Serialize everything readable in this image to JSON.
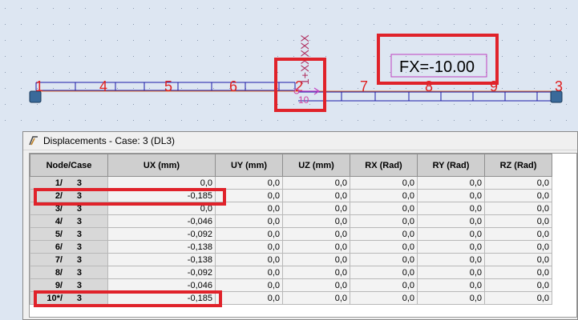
{
  "model": {
    "node_labels": [
      "1",
      "4",
      "5",
      "6",
      "2",
      "7",
      "8",
      "9",
      "3"
    ],
    "inner_node_label": "10",
    "member_label": "1+XXXXX",
    "load_label": "FX=-10.00"
  },
  "window": {
    "title": "Displacements - Case: 3 (DL3)",
    "icon": "table-window-icon"
  },
  "table": {
    "headers": [
      "Node/Case",
      "UX (mm)",
      "UY (mm)",
      "UZ (mm)",
      "RX (Rad)",
      "RY (Rad)",
      "RZ (Rad)"
    ],
    "rows": [
      {
        "node": "1/",
        "case": "3",
        "ux": "0,0",
        "uy": "0,0",
        "uz": "0,0",
        "rx": "0,0",
        "ry": "0,0",
        "rz": "0,0"
      },
      {
        "node": "2/",
        "case": "3",
        "ux": "-0,185",
        "uy": "0,0",
        "uz": "0,0",
        "rx": "0,0",
        "ry": "0,0",
        "rz": "0,0"
      },
      {
        "node": "3/",
        "case": "3",
        "ux": "0,0",
        "uy": "0,0",
        "uz": "0,0",
        "rx": "0,0",
        "ry": "0,0",
        "rz": "0,0"
      },
      {
        "node": "4/",
        "case": "3",
        "ux": "-0,046",
        "uy": "0,0",
        "uz": "0,0",
        "rx": "0,0",
        "ry": "0,0",
        "rz": "0,0"
      },
      {
        "node": "5/",
        "case": "3",
        "ux": "-0,092",
        "uy": "0,0",
        "uz": "0,0",
        "rx": "0,0",
        "ry": "0,0",
        "rz": "0,0"
      },
      {
        "node": "6/",
        "case": "3",
        "ux": "-0,138",
        "uy": "0,0",
        "uz": "0,0",
        "rx": "0,0",
        "ry": "0,0",
        "rz": "0,0"
      },
      {
        "node": "7/",
        "case": "3",
        "ux": "-0,138",
        "uy": "0,0",
        "uz": "0,0",
        "rx": "0,0",
        "ry": "0,0",
        "rz": "0,0"
      },
      {
        "node": "8/",
        "case": "3",
        "ux": "-0,092",
        "uy": "0,0",
        "uz": "0,0",
        "rx": "0,0",
        "ry": "0,0",
        "rz": "0,0"
      },
      {
        "node": "9/",
        "case": "3",
        "ux": "-0,046",
        "uy": "0,0",
        "uz": "0,0",
        "rx": "0,0",
        "ry": "0,0",
        "rz": "0,0"
      },
      {
        "node": "10*/",
        "case": "3",
        "ux": "-0,185",
        "uy": "0,0",
        "uz": "0,0",
        "rx": "0,0",
        "ry": "0,0",
        "rz": "0,0"
      }
    ]
  },
  "colors": {
    "highlight": "#e0222a",
    "node_label": "#e02020",
    "beam_axis": "#e07030",
    "beam_mesh": "#1a1aa8",
    "load_box": "#c040c0"
  }
}
